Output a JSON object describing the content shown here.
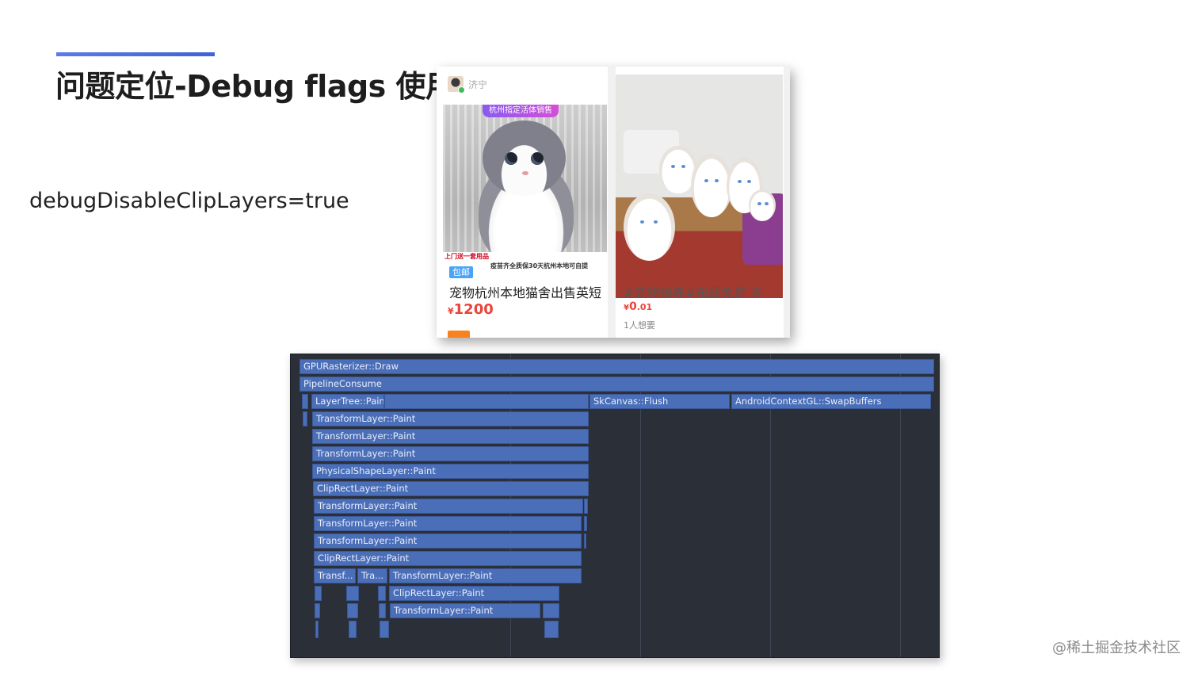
{
  "slide": {
    "title": "问题定位-Debug flags 使用",
    "code_label": "debugDisableClipLayers=true",
    "watermark": "@稀土掘金技术社区"
  },
  "screenshot": {
    "left_card": {
      "seller_name": "济宁",
      "image_badge": "杭州指定活体销售",
      "image_strip_1": "上门送一套用品",
      "image_strip_2": "疫苗齐全质保30天杭州本地可自提",
      "tag": "包邮",
      "title": "宠物杭州本地猫舍出售英短",
      "currency": "¥",
      "price": "1200"
    },
    "right_card": {
      "overlay_text": "#宠物领养#布偶免费 赤",
      "currency": "¥",
      "price_int": "0",
      "price_dec": ".01",
      "want_count": "1人想要"
    }
  },
  "flame_chart": {
    "labels": {
      "gpu_draw": "GPURasterizer::Draw",
      "pipeline": "PipelineConsume",
      "layertree": "LayerTree::Paint",
      "skcanvas": "SkCanvas::Flush",
      "swapbuffers": "AndroidContextGL::SwapBuffers",
      "transform_1": "TransformLayer::Paint",
      "transform_2": "TransformLayer::Paint",
      "transform_3": "TransformLayer::Paint",
      "physical": "PhysicalShapeLayer::Paint",
      "cliprect_1": "ClipRectLayer::Paint",
      "transform_4": "TransformLayer::Paint",
      "transform_5": "TransformLayer::Paint",
      "transform_6": "TransformLayer::Paint",
      "cliprect_2": "ClipRectLayer::Paint",
      "transf_short": "Transf...",
      "tra_short": "Tra...",
      "transform_7": "TransformLayer::Paint",
      "cliprect_3": "ClipRectLayer::Paint",
      "transform_8": "TransformLayer::Paint"
    }
  }
}
